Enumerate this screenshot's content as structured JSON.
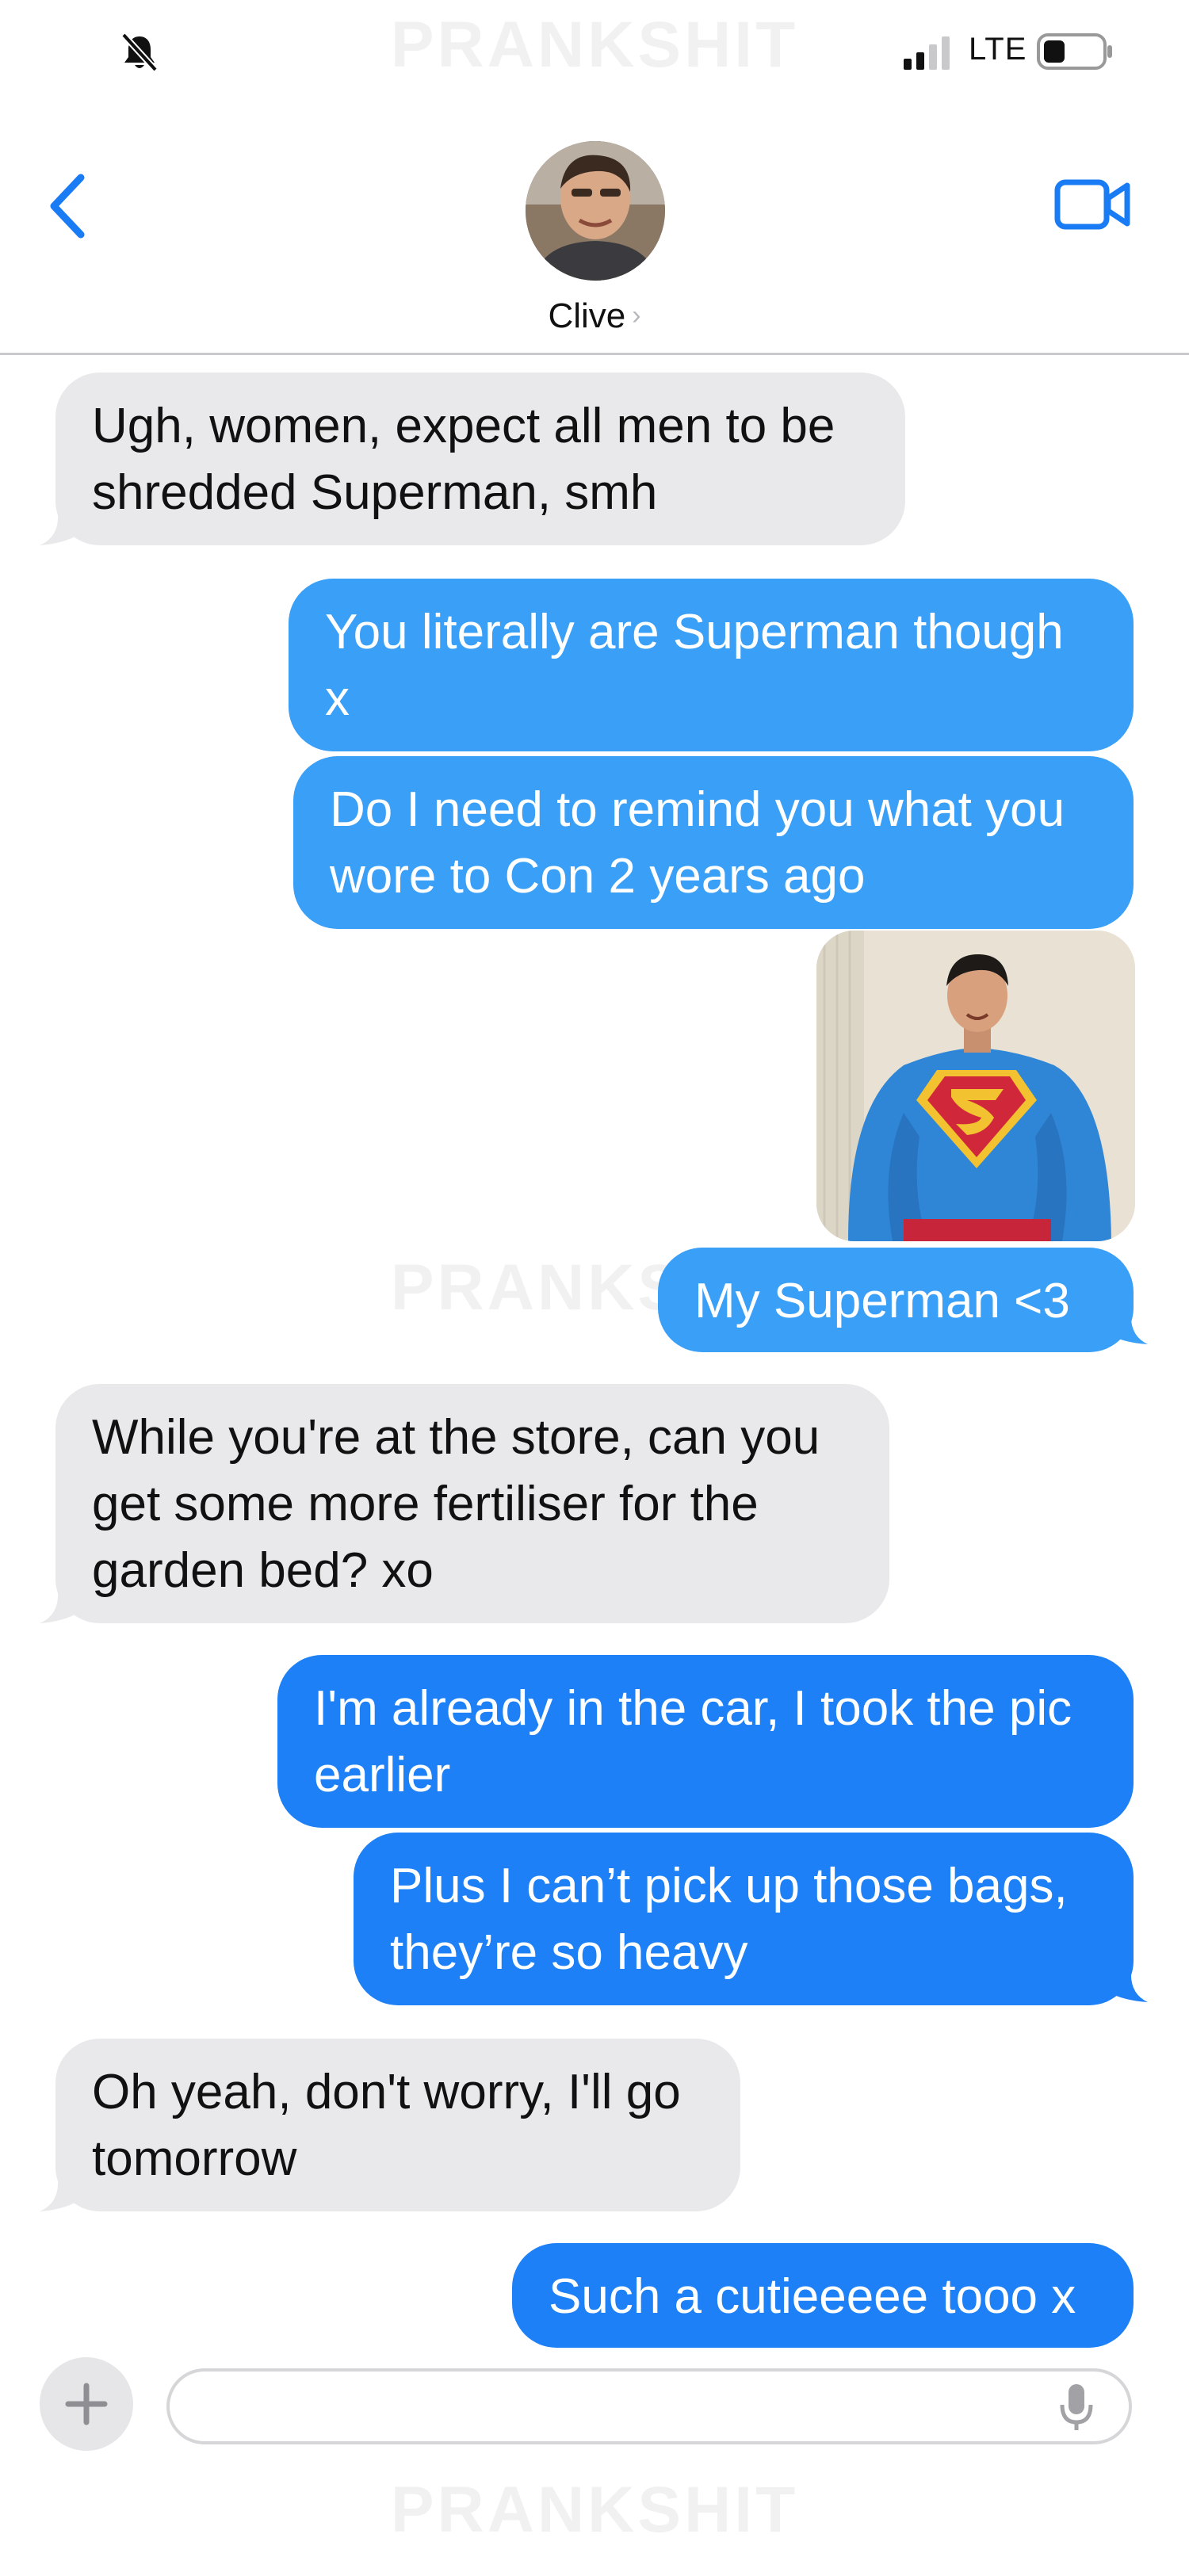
{
  "watermark": "PRANKSHIT",
  "status_bar": {
    "network": "LTE",
    "mute_icon": "bell-slash-icon",
    "signal_icon": "cellular-signal-icon",
    "battery_icon": "battery-icon"
  },
  "header": {
    "contact_name": "Clive",
    "chevron": "›",
    "back_icon": "chevron-left-icon",
    "video_icon": "video-camera-icon"
  },
  "messages": [
    {
      "direction": "incoming",
      "lines": [
        "Ugh, women, expect all men to be",
        "shredded Superman, smh"
      ]
    },
    {
      "direction": "outgoing",
      "lines": [
        "You literally are Superman though",
        "x"
      ]
    },
    {
      "direction": "outgoing",
      "lines": [
        "Do I need to remind you what you",
        "wore to Con 2 years ago"
      ]
    },
    {
      "direction": "outgoing",
      "type": "image",
      "image_icon": "superman-photo"
    },
    {
      "direction": "outgoing",
      "lines": [
        "My Superman <3"
      ]
    },
    {
      "direction": "incoming",
      "lines": [
        "While you're at the store, can you",
        "get some more fertiliser for the",
        "garden bed? xo"
      ]
    },
    {
      "direction": "outgoing",
      "lines": [
        "I'm already in the car, I took the pic",
        "earlier"
      ]
    },
    {
      "direction": "outgoing",
      "lines": [
        "Plus I can’t pick up those bags,",
        "they’re so heavy"
      ]
    },
    {
      "direction": "incoming",
      "lines": [
        "Oh yeah, don't worry, I'll go",
        "tomorrow"
      ]
    },
    {
      "direction": "outgoing",
      "lines": [
        "Such a cutieeeee tooo x"
      ]
    }
  ],
  "compose": {
    "placeholder": "",
    "value": "",
    "add_icon": "plus-icon",
    "mic_icon": "microphone-icon"
  },
  "colors": {
    "outgoing_bubble": "#3a9ff7",
    "outgoing_bubble_delivered": "#1d80f6",
    "incoming_bubble": "#e9e9eb",
    "accent": "#1a7cf5"
  }
}
